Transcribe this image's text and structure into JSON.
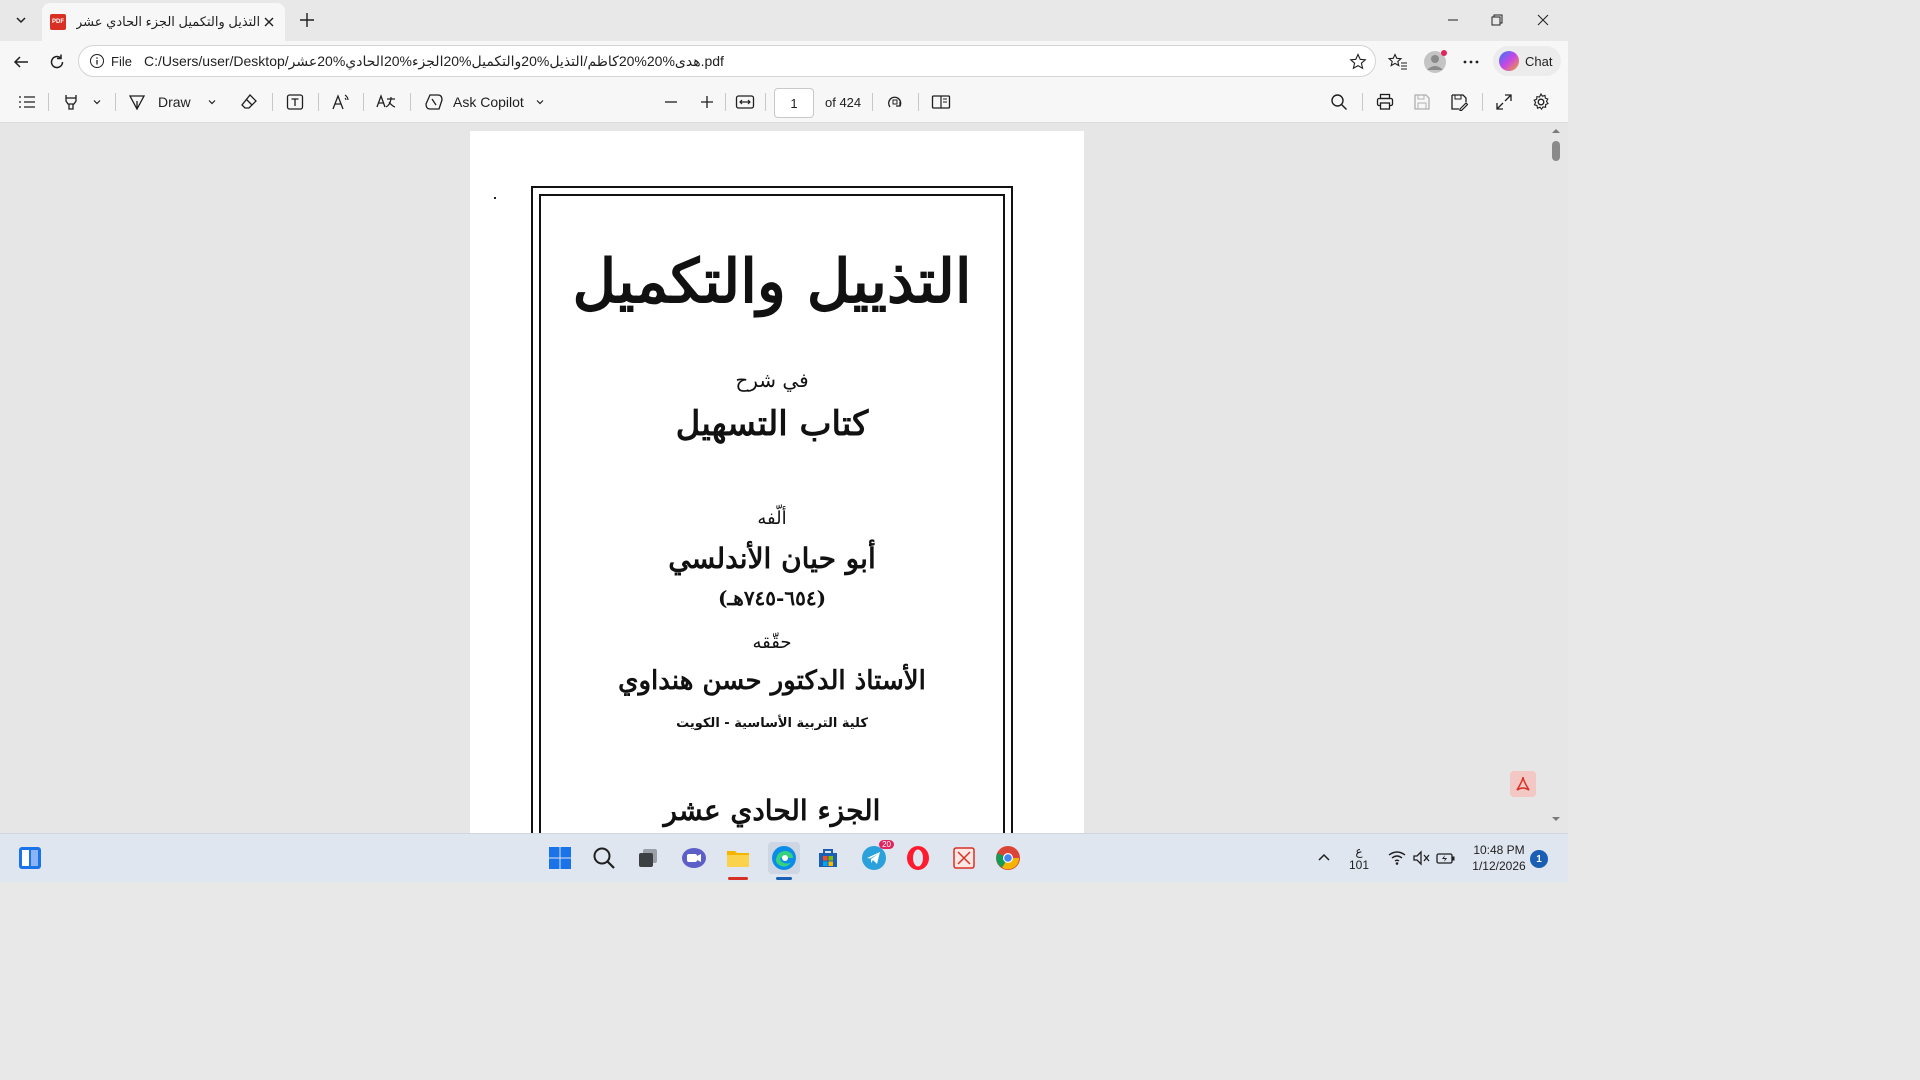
{
  "browser": {
    "tab_title": "التذيل والتكميل الجزء الحادي عشر.pdf",
    "pdf_favicon": "PDF",
    "address_label": "File",
    "url": "C:/Users/user/Desktop/هدى%20%20كاظم/التذيل%20والتكميل%20الجزء%20الحادي%20عشر.pdf",
    "chat_label": "Chat"
  },
  "pdf_toolbar": {
    "draw_label": "Draw",
    "ask_copilot_label": "Ask Copilot",
    "page_number": "1",
    "page_of": "of 424"
  },
  "document": {
    "title": "التذييل والتكميل",
    "in_sharh": "في شرح",
    "book": "كتاب التسهيل",
    "authored_by": "ألّفه",
    "author": "أبو حيان الأندلسي",
    "years": "(٦٥٤-٧٤٥هـ)",
    "edited_by": "حقّقه",
    "editor": "الأستاذ الدكتور حسن هنداوي",
    "affiliation": "كلية التربية الأساسية - الكويت",
    "volume": "الجزء الحادي عشر"
  },
  "taskbar": {
    "lang_top": "ع",
    "lang_bottom": "101",
    "time": "10:48 PM",
    "date": "1/12/2026",
    "telegram_badge": "20",
    "notification_count": "1"
  }
}
